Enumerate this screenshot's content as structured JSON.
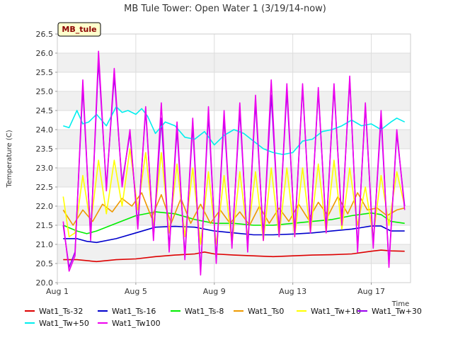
{
  "chart_data": {
    "type": "line",
    "title": "MB Tule Tower: Open Water 1 (3/19/14-now)",
    "xlabel": "Time",
    "ylabel": "Temperature (C)",
    "badge": "MB_tule",
    "xlim": [
      0,
      18
    ],
    "ylim": [
      20.0,
      26.5
    ],
    "xticks": [
      {
        "label": "Aug 1",
        "day": 0
      },
      {
        "label": "Aug 5",
        "day": 4
      },
      {
        "label": "Aug 9",
        "day": 8
      },
      {
        "label": "Aug 13",
        "day": 12
      },
      {
        "label": "Aug 17",
        "day": 16
      }
    ],
    "yticks": [
      "20.0",
      "20.5",
      "21.0",
      "21.5",
      "22.0",
      "22.5",
      "23.0",
      "23.5",
      "24.0",
      "24.5",
      "25.0",
      "25.5",
      "26.0",
      "26.5"
    ],
    "grid": true,
    "legend_position": "bottom",
    "series": [
      {
        "name": "Wat1_Ts-32",
        "color": "#dd0000",
        "x": [
          0.3,
          1,
          2,
          3,
          4,
          5,
          6,
          7,
          7.5,
          8,
          9,
          10,
          11,
          12,
          13,
          14,
          15,
          16,
          16.5,
          17,
          17.7
        ],
        "y": [
          20.6,
          20.6,
          20.55,
          20.6,
          20.62,
          20.68,
          20.72,
          20.75,
          20.8,
          20.75,
          20.72,
          20.7,
          20.68,
          20.7,
          20.72,
          20.73,
          20.75,
          20.82,
          20.85,
          20.83,
          20.82
        ]
      },
      {
        "name": "Wat1_Ts-16",
        "color": "#0000cc",
        "x": [
          0.3,
          1,
          1.5,
          2,
          3,
          4,
          5,
          6,
          7,
          8,
          9,
          10,
          11,
          12,
          13,
          14,
          15,
          16,
          16.5,
          17,
          17.7
        ],
        "y": [
          21.15,
          21.15,
          21.08,
          21.05,
          21.15,
          21.3,
          21.45,
          21.47,
          21.45,
          21.35,
          21.3,
          21.25,
          21.25,
          21.27,
          21.3,
          21.35,
          21.4,
          21.48,
          21.48,
          21.35,
          21.35
        ]
      },
      {
        "name": "Wat1_Ts-8",
        "color": "#00ee00",
        "x": [
          0.3,
          1,
          1.5,
          2,
          3,
          4,
          5,
          6,
          7,
          8,
          9,
          10,
          11,
          12,
          13,
          14,
          15,
          16,
          16.5,
          17,
          17.7
        ],
        "y": [
          21.5,
          21.35,
          21.28,
          21.35,
          21.55,
          21.75,
          21.85,
          21.8,
          21.65,
          21.55,
          21.55,
          21.5,
          21.5,
          21.55,
          21.6,
          21.65,
          21.75,
          21.82,
          21.78,
          21.6,
          21.55
        ]
      },
      {
        "name": "Wat1_Ts0",
        "color": "#ee9900",
        "x": [
          0.3,
          0.8,
          1.3,
          1.8,
          2.3,
          2.8,
          3.3,
          3.8,
          4.3,
          4.8,
          5.3,
          5.8,
          6.3,
          6.8,
          7.3,
          7.8,
          8.3,
          8.8,
          9.3,
          9.8,
          10.3,
          10.8,
          11.3,
          11.8,
          12.3,
          12.8,
          13.3,
          13.8,
          14.3,
          14.8,
          15.3,
          15.8,
          16.3,
          16.8,
          17.3,
          17.7
        ],
        "y": [
          21.9,
          21.5,
          21.9,
          21.6,
          22.05,
          21.85,
          22.2,
          22.0,
          22.35,
          21.7,
          22.3,
          21.55,
          22.2,
          21.55,
          22.05,
          21.55,
          21.9,
          21.55,
          21.85,
          21.5,
          22.0,
          21.55,
          21.95,
          21.6,
          22.05,
          21.65,
          22.1,
          21.75,
          22.25,
          21.8,
          22.35,
          21.9,
          21.95,
          21.75,
          21.9,
          21.95
        ]
      },
      {
        "name": "Wat1_Tw+10",
        "color": "#ffff00",
        "x": [
          0.3,
          0.6,
          0.9,
          1.3,
          1.7,
          2.1,
          2.5,
          2.9,
          3.3,
          3.7,
          4.1,
          4.5,
          4.9,
          5.3,
          5.7,
          6.1,
          6.5,
          6.9,
          7.3,
          7.7,
          8.1,
          8.5,
          8.9,
          9.3,
          9.7,
          10.1,
          10.5,
          10.9,
          11.3,
          11.7,
          12.1,
          12.5,
          12.9,
          13.3,
          13.7,
          14.1,
          14.5,
          14.9,
          15.3,
          15.7,
          16.1,
          16.5,
          16.9,
          17.3,
          17.7
        ],
        "y": [
          22.25,
          21.2,
          21.3,
          22.8,
          21.5,
          23.2,
          21.8,
          23.2,
          22.0,
          23.5,
          21.9,
          23.4,
          21.5,
          23.4,
          21.3,
          23.1,
          21.2,
          23.0,
          21.0,
          22.9,
          21.0,
          22.8,
          21.0,
          22.9,
          21.2,
          22.9,
          21.1,
          23.0,
          21.2,
          23.0,
          21.2,
          23.0,
          21.3,
          23.1,
          21.3,
          23.2,
          21.4,
          23.0,
          21.5,
          22.5,
          21.2,
          22.8,
          21.5,
          22.9,
          22.0
        ]
      },
      {
        "name": "Wat1_Tw+30",
        "color": "#9900ee",
        "x": [
          0.3,
          0.6,
          0.9,
          1.3,
          1.7,
          2.1,
          2.5,
          2.9,
          3.3,
          3.7,
          4.1,
          4.5,
          4.9,
          5.3,
          5.7,
          6.1,
          6.5,
          6.9,
          7.3,
          7.7,
          8.1,
          8.5,
          8.9,
          9.3,
          9.7,
          10.1,
          10.5,
          10.9,
          11.3,
          11.7,
          12.1,
          12.5,
          12.9,
          13.3,
          13.7,
          14.1,
          14.5,
          14.9,
          15.3,
          15.7,
          16.1,
          16.5,
          16.9,
          17.3,
          17.7
        ],
        "y": [
          21.5,
          20.4,
          20.8,
          25.1,
          21.2,
          25.8,
          22.5,
          25.4,
          22.6,
          23.9,
          21.5,
          24.5,
          21.2,
          24.3,
          20.9,
          24.0,
          20.7,
          24.1,
          20.3,
          24.4,
          20.6,
          24.3,
          21.0,
          24.5,
          20.9,
          24.7,
          21.2,
          24.9,
          21.3,
          25.0,
          21.3,
          25.1,
          21.4,
          25.0,
          21.4,
          25.1,
          21.6,
          25.3,
          20.9,
          24.6,
          21.0,
          24.3,
          20.5,
          23.9,
          22.0
        ]
      },
      {
        "name": "Wat1_Tw+50",
        "color": "#00eeee",
        "x": [
          0.3,
          0.6,
          1.0,
          1.3,
          1.6,
          2.0,
          2.5,
          3.0,
          3.3,
          3.6,
          4.0,
          4.3,
          4.6,
          5.0,
          5.5,
          6.0,
          6.5,
          7.0,
          7.5,
          8.0,
          8.5,
          9.0,
          9.5,
          10.0,
          10.5,
          11.0,
          11.5,
          12.0,
          12.5,
          13.0,
          13.5,
          14.0,
          14.5,
          15.0,
          15.5,
          16.0,
          16.5,
          17.0,
          17.3,
          17.7
        ],
        "y": [
          24.1,
          24.05,
          24.5,
          24.15,
          24.2,
          24.4,
          24.1,
          24.6,
          24.45,
          24.5,
          24.4,
          24.55,
          24.35,
          23.9,
          24.2,
          24.1,
          23.8,
          23.75,
          23.95,
          23.6,
          23.85,
          24.0,
          23.9,
          23.7,
          23.5,
          23.4,
          23.35,
          23.4,
          23.7,
          23.75,
          23.95,
          24.0,
          24.1,
          24.25,
          24.1,
          24.15,
          24.0,
          24.2,
          24.3,
          24.2
        ]
      },
      {
        "name": "Wat1_Tw100",
        "color": "#ee00ee",
        "x": [
          0.3,
          0.6,
          0.9,
          1.3,
          1.7,
          2.1,
          2.5,
          2.9,
          3.3,
          3.7,
          4.1,
          4.5,
          4.9,
          5.3,
          5.7,
          6.1,
          6.5,
          6.9,
          7.3,
          7.7,
          8.1,
          8.5,
          8.9,
          9.3,
          9.7,
          10.1,
          10.5,
          10.9,
          11.3,
          11.7,
          12.1,
          12.5,
          12.9,
          13.3,
          13.7,
          14.1,
          14.5,
          14.9,
          15.3,
          15.7,
          16.1,
          16.5,
          16.9,
          17.3,
          17.7
        ],
        "y": [
          21.6,
          20.3,
          20.7,
          25.3,
          21.1,
          26.05,
          22.4,
          25.6,
          22.5,
          24.0,
          21.4,
          24.6,
          21.1,
          24.7,
          20.8,
          24.2,
          20.6,
          24.3,
          20.2,
          24.6,
          20.5,
          24.5,
          20.9,
          24.7,
          20.8,
          24.9,
          21.1,
          25.3,
          21.2,
          25.2,
          21.2,
          25.2,
          21.3,
          25.1,
          21.3,
          25.2,
          21.5,
          25.4,
          20.8,
          24.7,
          20.9,
          24.5,
          20.4,
          24.0,
          21.9
        ]
      }
    ]
  }
}
